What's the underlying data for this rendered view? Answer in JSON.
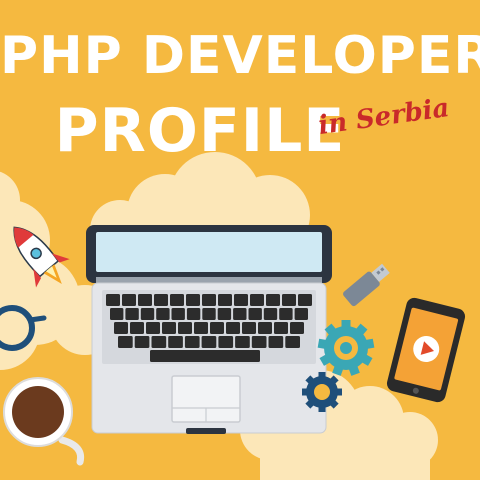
{
  "header": {
    "title_line_1": "PHP DEVELOPER",
    "title_line_2": "PROFILE",
    "subtitle": "in Serbia"
  },
  "colors": {
    "background": "#f5b940",
    "title": "#ffffff",
    "subtitle": "#c92a2a",
    "laptop_body": "#e4e6ea",
    "laptop_screen": "#cfe9f3",
    "gear": "#3aa7b5",
    "phone_screen": "#f4a236"
  },
  "icons": [
    "rocket-icon",
    "laptop-icon",
    "usb-drive-icon",
    "gear-icon",
    "smartphone-icon",
    "play-icon",
    "glasses-icon",
    "coffee-cup-icon",
    "cloud-icon"
  ]
}
